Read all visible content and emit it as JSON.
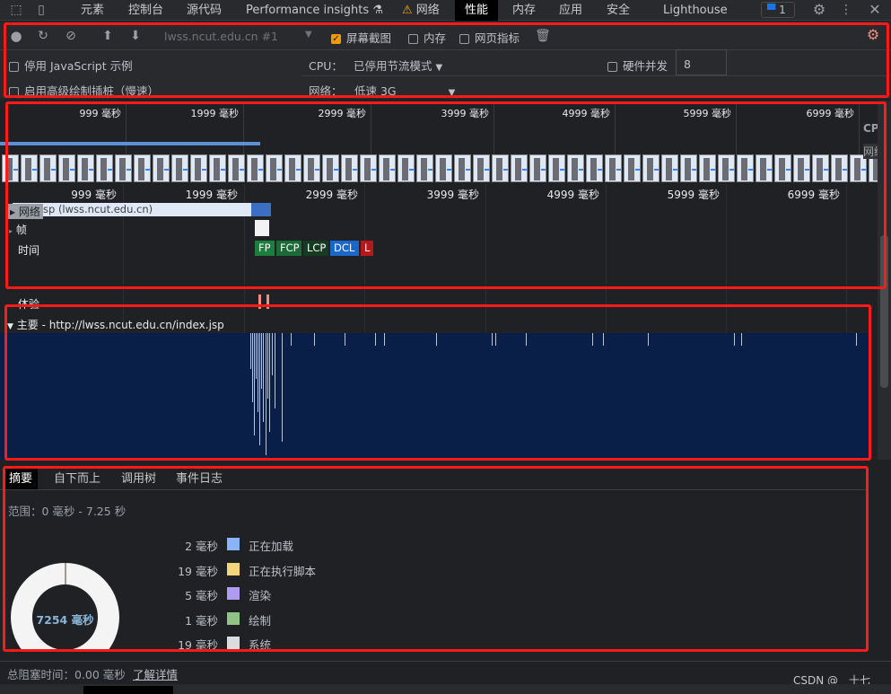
{
  "tabs": [
    {
      "label": "元素"
    },
    {
      "label": "控制台"
    },
    {
      "label": "源代码"
    },
    {
      "label": "Performance insights"
    },
    {
      "label": "网络"
    },
    {
      "label": "性能"
    },
    {
      "label": "内存"
    },
    {
      "label": "应用"
    },
    {
      "label": "安全"
    },
    {
      "label": "Lighthouse"
    }
  ],
  "issues_count": "1",
  "toolbar": {
    "target": "lwss.ncut.edu.cn #1",
    "screenshots": "屏幕截图",
    "screenshots_checked": true,
    "memory": "内存",
    "web_vitals": "网页指标",
    "disable_js_samples": "停用 JavaScript 示例",
    "advanced_paint": "启用高级绘制插桩（慢速）",
    "cpu_label": "CPU：",
    "cpu_value": "已停用节流模式",
    "network_label": "网络：",
    "network_value": "低速 3G",
    "hw_concurrency": "硬件并发",
    "hw_value": "8"
  },
  "overview": {
    "ticks": [
      "999 毫秒",
      "1999 毫秒",
      "2999 毫秒",
      "3999 毫秒",
      "4999 毫秒",
      "5999 毫秒",
      "6999 毫秒"
    ],
    "cpu": "CPU",
    "net": "网络"
  },
  "tracks": {
    "network": "网络",
    "network_item": "sp (lwss.ncut.edu.cn)",
    "frames": "帧",
    "timings": "时间",
    "experience": "体验",
    "main": "主要 - http://lwss.ncut.edu.cn/index.jsp"
  },
  "markers": [
    {
      "label": "FP",
      "color": "#1e7e3e"
    },
    {
      "label": "FCP",
      "color": "#1b6b36"
    },
    {
      "label": "LCP",
      "color": "#173a22"
    },
    {
      "label": "DCL",
      "color": "#1a66c9"
    },
    {
      "label": "L",
      "color": "#b3191b"
    }
  ],
  "bottom_tabs": [
    {
      "label": "摘要"
    },
    {
      "label": "自下而上"
    },
    {
      "label": "调用树"
    },
    {
      "label": "事件日志"
    }
  ],
  "summary": {
    "range": "范围：0 毫秒 - 7.25 秒",
    "total": "7254 毫秒",
    "items": [
      {
        "value": "2 毫秒",
        "label": "正在加载",
        "color": "#8ab4f8"
      },
      {
        "value": "19 毫秒",
        "label": "正在执行脚本",
        "color": "#f3d57b"
      },
      {
        "value": "5 毫秒",
        "label": "渲染",
        "color": "#af9cf0"
      },
      {
        "value": "1 毫秒",
        "label": "绘制",
        "color": "#8fc486"
      },
      {
        "value": "19 毫秒",
        "label": "系统",
        "color": "#dadce0"
      }
    ]
  },
  "footer": {
    "tbt": "总阻塞时间：0.00 毫秒",
    "learn_more": "了解详情",
    "watermark": "CSDN @__十七"
  }
}
